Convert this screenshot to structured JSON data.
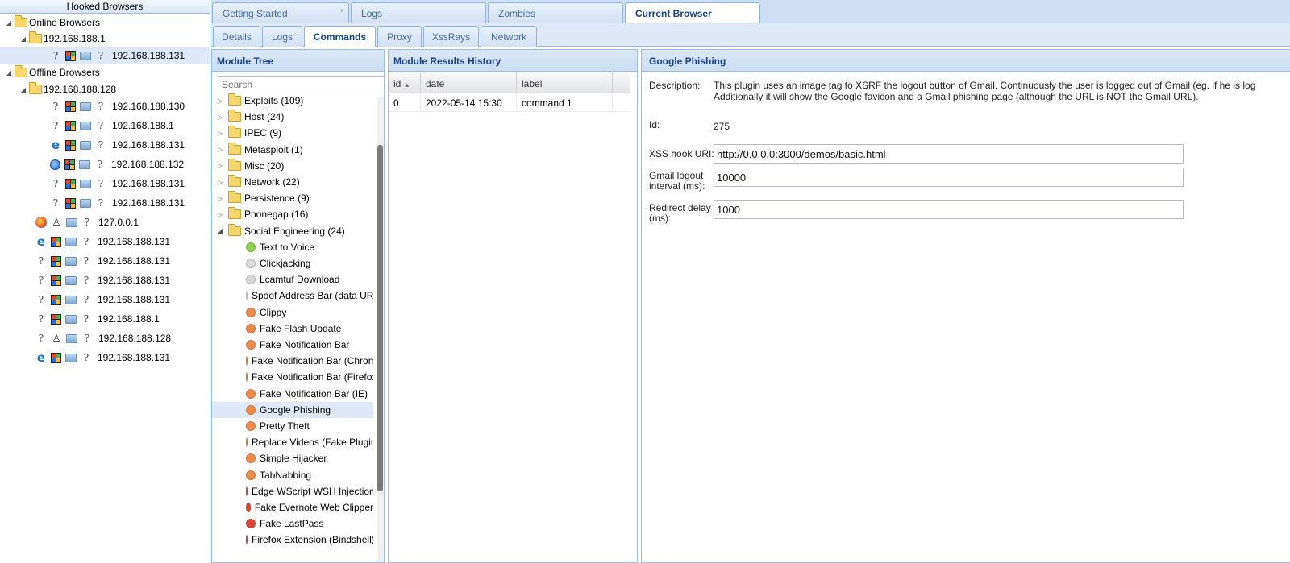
{
  "hooked": {
    "title": "Hooked Browsers",
    "online_label": "Online Browsers",
    "online_group": "192.168.188.1",
    "online_items": [
      {
        "icons": [
          "q",
          "win",
          "pc",
          "q"
        ],
        "ip": "192.168.188.131"
      }
    ],
    "offline_label": "Offline Browsers",
    "offline_group": "192.168.188.128",
    "offline_group_items": [
      {
        "icons": [
          "q",
          "win",
          "pc",
          "q"
        ],
        "ip": "192.168.188.130"
      },
      {
        "icons": [
          "q",
          "win",
          "pc",
          "q"
        ],
        "ip": "192.168.188.1"
      },
      {
        "icons": [
          "ie",
          "win",
          "pc",
          "q"
        ],
        "ip": "192.168.188.131"
      },
      {
        "icons": [
          "ie2",
          "win",
          "pc",
          "q"
        ],
        "ip": "192.168.188.132"
      },
      {
        "icons": [
          "q",
          "win",
          "pc",
          "q"
        ],
        "ip": "192.168.188.131"
      },
      {
        "icons": [
          "q",
          "win",
          "pc",
          "q"
        ],
        "ip": "192.168.188.131"
      }
    ],
    "offline_items": [
      {
        "icons": [
          "ff",
          "tux",
          "pc",
          "q"
        ],
        "ip": "127.0.0.1"
      },
      {
        "icons": [
          "ie",
          "win",
          "pc",
          "q"
        ],
        "ip": "192.168.188.131"
      },
      {
        "icons": [
          "q",
          "win",
          "pc",
          "q"
        ],
        "ip": "192.168.188.131"
      },
      {
        "icons": [
          "q",
          "win",
          "pc",
          "q"
        ],
        "ip": "192.168.188.131"
      },
      {
        "icons": [
          "q",
          "win",
          "pc",
          "q"
        ],
        "ip": "192.168.188.131"
      },
      {
        "icons": [
          "q",
          "win",
          "pc",
          "q"
        ],
        "ip": "192.168.188.1"
      },
      {
        "icons": [
          "q",
          "tux",
          "pc",
          "q"
        ],
        "ip": "192.168.188.128"
      },
      {
        "icons": [
          "ie",
          "win",
          "pc",
          "q"
        ],
        "ip": "192.168.188.131"
      }
    ]
  },
  "main_tabs": [
    "Getting Started",
    "Logs",
    "Zombies",
    "Current Browser"
  ],
  "close_glyph": "×",
  "sub_tabs": [
    "Details",
    "Logs",
    "Commands",
    "Proxy",
    "XssRays",
    "Network"
  ],
  "module_tree": {
    "title": "Module Tree",
    "search_placeholder": "Search",
    "categories": [
      {
        "label": "Exploits (109)",
        "open": false
      },
      {
        "label": "Host (24)",
        "open": false
      },
      {
        "label": "IPEC (9)",
        "open": false
      },
      {
        "label": "Metasploit (1)",
        "open": false
      },
      {
        "label": "Misc (20)",
        "open": false
      },
      {
        "label": "Network (22)",
        "open": false
      },
      {
        "label": "Persistence (9)",
        "open": false
      },
      {
        "label": "Phonegap (16)",
        "open": false
      },
      {
        "label": "Social Engineering (24)",
        "open": true
      }
    ],
    "modules": [
      {
        "label": "Text to Voice",
        "color": "#8fd14f"
      },
      {
        "label": "Clickjacking",
        "color": "#d8d8d8"
      },
      {
        "label": "Lcamtuf Download",
        "color": "#d8d8d8"
      },
      {
        "label": "Spoof Address Bar (data URL)",
        "color": "#d8d8d8"
      },
      {
        "label": "Clippy",
        "color": "#ee8a4a"
      },
      {
        "label": "Fake Flash Update",
        "color": "#ee8a4a"
      },
      {
        "label": "Fake Notification Bar",
        "color": "#ee8a4a"
      },
      {
        "label": "Fake Notification Bar (Chrome)",
        "color": "#ee8a4a"
      },
      {
        "label": "Fake Notification Bar (Firefox)",
        "color": "#ee8a4a"
      },
      {
        "label": "Fake Notification Bar (IE)",
        "color": "#ee8a4a"
      },
      {
        "label": "Google Phishing",
        "color": "#ee8a4a"
      },
      {
        "label": "Pretty Theft",
        "color": "#ee8a4a"
      },
      {
        "label": "Replace Videos (Fake Plugin)",
        "color": "#ee8a4a"
      },
      {
        "label": "Simple Hijacker",
        "color": "#ee8a4a"
      },
      {
        "label": "TabNabbing",
        "color": "#ee8a4a"
      },
      {
        "label": "Edge WScript WSH Injection",
        "color": "#d9473a"
      },
      {
        "label": "Fake Evernote Web Clipper",
        "color": "#d9473a"
      },
      {
        "label": "Fake LastPass",
        "color": "#d9473a"
      },
      {
        "label": "Firefox Extension (Bindshell)",
        "color": "#d9473a"
      }
    ]
  },
  "results": {
    "title": "Module Results History",
    "columns": [
      "id",
      "date",
      "label"
    ],
    "rows": [
      {
        "id": "0",
        "date": "2022-05-14 15:30",
        "label": "command 1"
      }
    ]
  },
  "details": {
    "title": "Google Phishing",
    "description_label": "Description:",
    "description_line1": "This plugin uses an image tag to XSRF the logout button of Gmail. Continuously the user is logged out of Gmail (eg. if he is log",
    "description_line2": "Additionally it will show the Google favicon and a Gmail phishing page (although the URL is NOT the Gmail URL).",
    "id_label": "Id:",
    "id_value": "275",
    "xss_label": "XSS hook URI:",
    "xss_value": "http://0.0.0.0:3000/demos/basic.html",
    "gmail_label_1": "Gmail logout",
    "gmail_label_2": "interval (ms):",
    "gmail_value": "10000",
    "redirect_label_1": "Redirect delay",
    "redirect_label_2": "(ms):",
    "redirect_value": "1000"
  }
}
